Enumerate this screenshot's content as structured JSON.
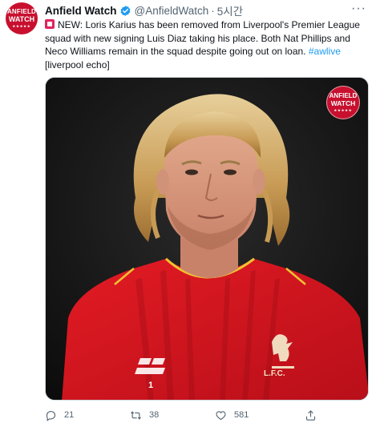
{
  "author": {
    "name": "Anfield Watch",
    "handle": "@AnfieldWatch",
    "separator": "·",
    "time": "5시간",
    "avatar_text_line1": "ANFIELD",
    "avatar_text_line2": "WATCH"
  },
  "tweet": {
    "text": "NEW: Loris Karius has been removed from Liverpool's Premier League squad with new signing Luis Diaz taking his place. Both Nat Phillips and Neco Williams remain in the squad despite going out on loan. ",
    "hashtag": "#awlive",
    "source": "[liverpool echo]"
  },
  "media": {
    "logo_line1": "ANFIELD",
    "logo_line2": "WATCH",
    "shirt_brand_text": "L.F.C.",
    "shirt_number": "1"
  },
  "actions": {
    "replies": "21",
    "retweets": "38",
    "likes": "581"
  },
  "colors": {
    "brand_red": "#c8102e",
    "link_blue": "#1d9bf0",
    "muted_gray": "#536471"
  },
  "icons": [
    "verified-badge-icon",
    "more-icon",
    "reply-icon",
    "retweet-icon",
    "like-icon",
    "share-icon"
  ]
}
